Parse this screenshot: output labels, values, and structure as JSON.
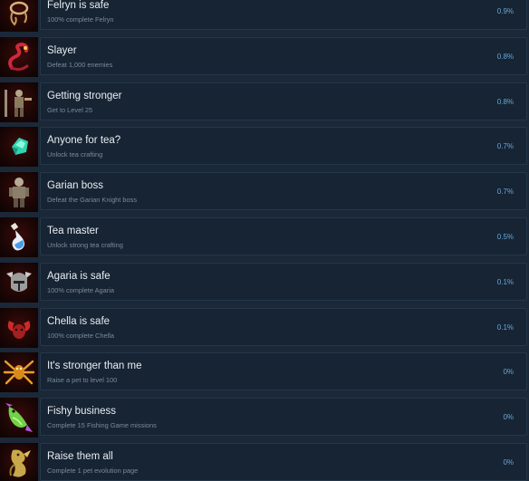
{
  "achievements": [
    {
      "title": "Felryn is safe",
      "description": "100% complete Felryn",
      "percent": "0.9%",
      "icon": "rope-icon"
    },
    {
      "title": "Slayer",
      "description": "Defeat 1,000 enemies",
      "percent": "0.8%",
      "icon": "serpent-icon"
    },
    {
      "title": "Getting stronger",
      "description": "Get to Level 25",
      "percent": "0.8%",
      "icon": "warrior-icon"
    },
    {
      "title": "Anyone for tea?",
      "description": "Unlock tea crafting",
      "percent": "0.7%",
      "icon": "gem-icon"
    },
    {
      "title": "Garian boss",
      "description": "Defeat the Garian Knight boss",
      "percent": "0.7%",
      "icon": "knight-icon"
    },
    {
      "title": "Tea master",
      "description": "Unlock strong tea crafting",
      "percent": "0.5%",
      "icon": "potion-icon"
    },
    {
      "title": "Agaria is safe",
      "description": "100% complete Agaria",
      "percent": "0.1%",
      "icon": "helmet-icon"
    },
    {
      "title": "Chella is safe",
      "description": "100% complete Chella",
      "percent": "0.1%",
      "icon": "horns-icon"
    },
    {
      "title": "It's stronger than me",
      "description": "Raise a pet to level 100",
      "percent": "0%",
      "icon": "spider-icon"
    },
    {
      "title": "Fishy business",
      "description": "Complete 15 Fishing Game missions",
      "percent": "0%",
      "icon": "fish-icon"
    },
    {
      "title": "Raise them all",
      "description": "Complete 1 pet evolution page",
      "percent": "0%",
      "icon": "dragon-icon"
    }
  ]
}
